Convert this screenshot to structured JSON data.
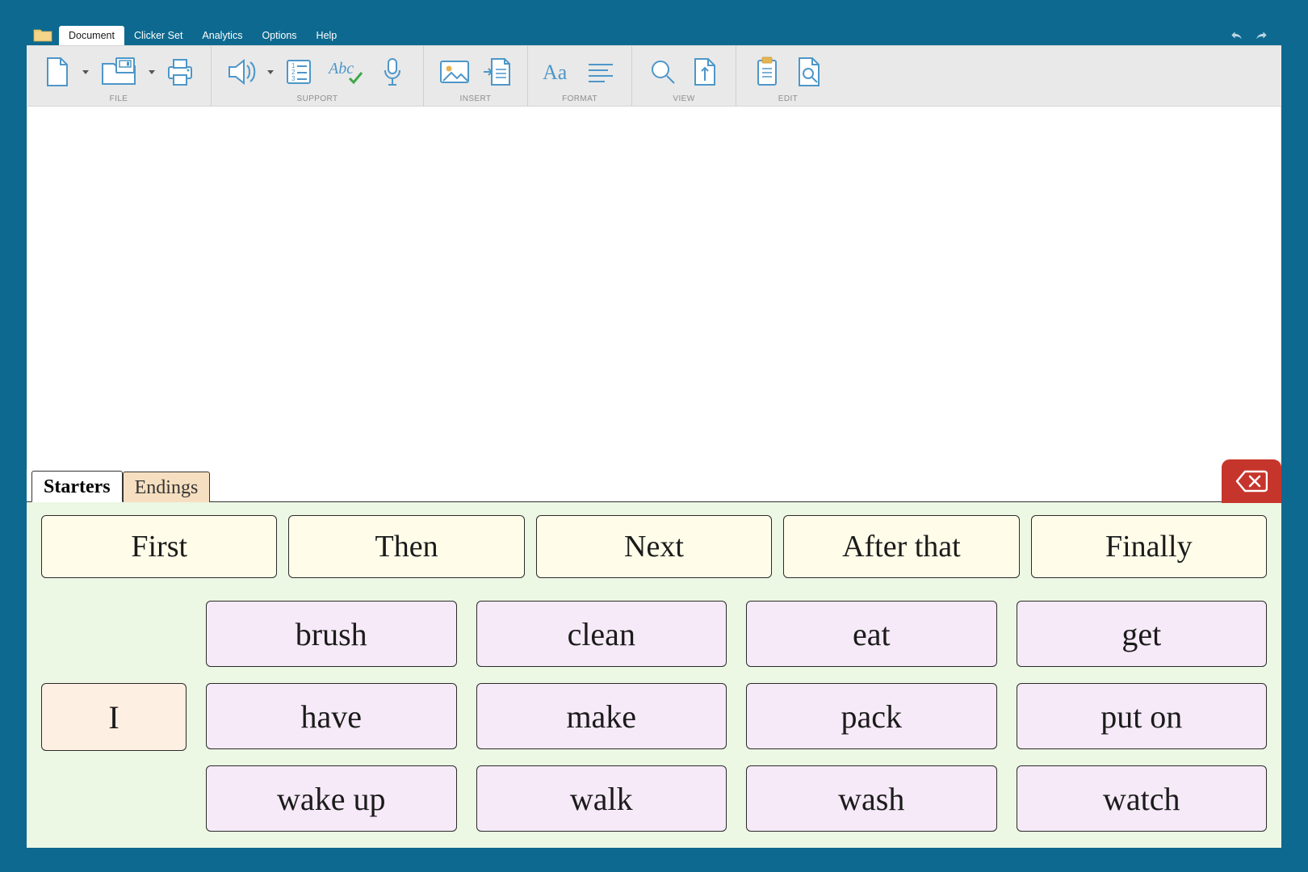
{
  "menu": {
    "tabs": [
      "Document",
      "Clicker Set",
      "Analytics",
      "Options",
      "Help"
    ],
    "active_index": 0
  },
  "ribbon": {
    "groups": [
      {
        "label": "FILE"
      },
      {
        "label": "SUPPORT"
      },
      {
        "label": "INSERT"
      },
      {
        "label": "FORMAT"
      },
      {
        "label": "VIEW"
      },
      {
        "label": "EDIT"
      }
    ]
  },
  "grid": {
    "tabs": [
      {
        "label": "Starters",
        "active": true
      },
      {
        "label": "Endings",
        "active": false
      }
    ],
    "starter_words": [
      "First",
      "Then",
      "Next",
      "After that",
      "Finally"
    ],
    "subject": "I",
    "verbs": [
      "brush",
      "clean",
      "eat",
      "get",
      "have",
      "make",
      "pack",
      "put on",
      "wake up",
      "walk",
      "wash",
      "watch"
    ]
  },
  "colors": {
    "frame": "#0d698f",
    "ribbon_bg": "#e9e9e9",
    "grid_bg": "#ecf7e4",
    "starter_fill": "#fffde9",
    "subject_fill": "#fdefe2",
    "verb_fill": "#f6eaf8",
    "delete_bg": "#c6352c",
    "icon_stroke": "#4d97c9",
    "icon_accent": "#e9b353"
  }
}
